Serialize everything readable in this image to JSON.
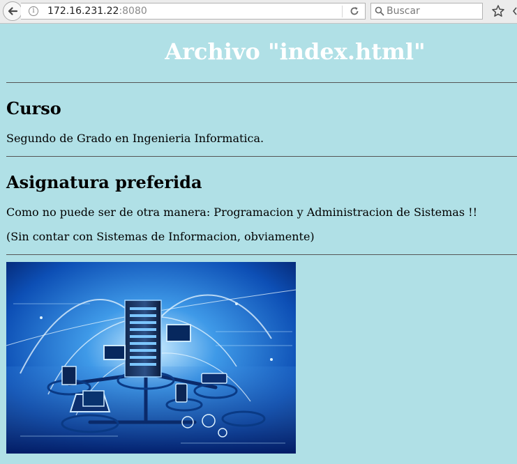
{
  "browser": {
    "url_host": "172.16.231.22",
    "url_port": ":8080",
    "search_placeholder": "Buscar"
  },
  "page": {
    "title": "Archivo \"index.html\"",
    "sections": [
      {
        "heading": "Curso",
        "paragraphs": [
          "Segundo de Grado en Ingenieria Informatica."
        ]
      },
      {
        "heading": "Asignatura preferida",
        "paragraphs": [
          "Como no puede ser de otra manera: Programacion y Administracion de Sistemas !!",
          "(Sin contar con Sistemas de Informacion, obviamente)"
        ]
      }
    ],
    "image": {
      "subject": "network-server-illustration"
    }
  },
  "colors": {
    "page_background": "#b0e0e6",
    "title_color": "#ffffff"
  }
}
